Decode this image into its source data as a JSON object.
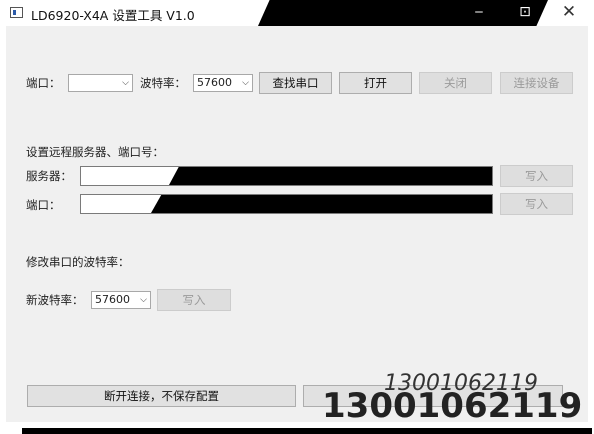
{
  "window": {
    "title": "LD6920-X4A 设置工具 V1.0",
    "min_glyph": "‒",
    "max_glyph": "⊡",
    "close_glyph": "✕"
  },
  "connection": {
    "port_label": "端口：",
    "port_value": "",
    "baud_label": "波特率：",
    "baud_value": "57600",
    "find_port_button": "查找串口",
    "open_button": "打开",
    "close_button": "关闭",
    "connect_device_button": "连接设备"
  },
  "remote": {
    "section_title": "设置远程服务器、端口号：",
    "server_label": "服务器：",
    "server_write_button": "写入",
    "port_label": "端口：",
    "port_write_button": "写入"
  },
  "serial_baud": {
    "section_title": "修改串口的波特率：",
    "new_baud_label": "新波特率：",
    "new_baud_value": "57600",
    "write_button": "写入"
  },
  "footer": {
    "disconnect_button": "断开连接，不保存配置"
  },
  "watermark": {
    "thin_text": "13001062119",
    "bold_text": "13001062119"
  }
}
